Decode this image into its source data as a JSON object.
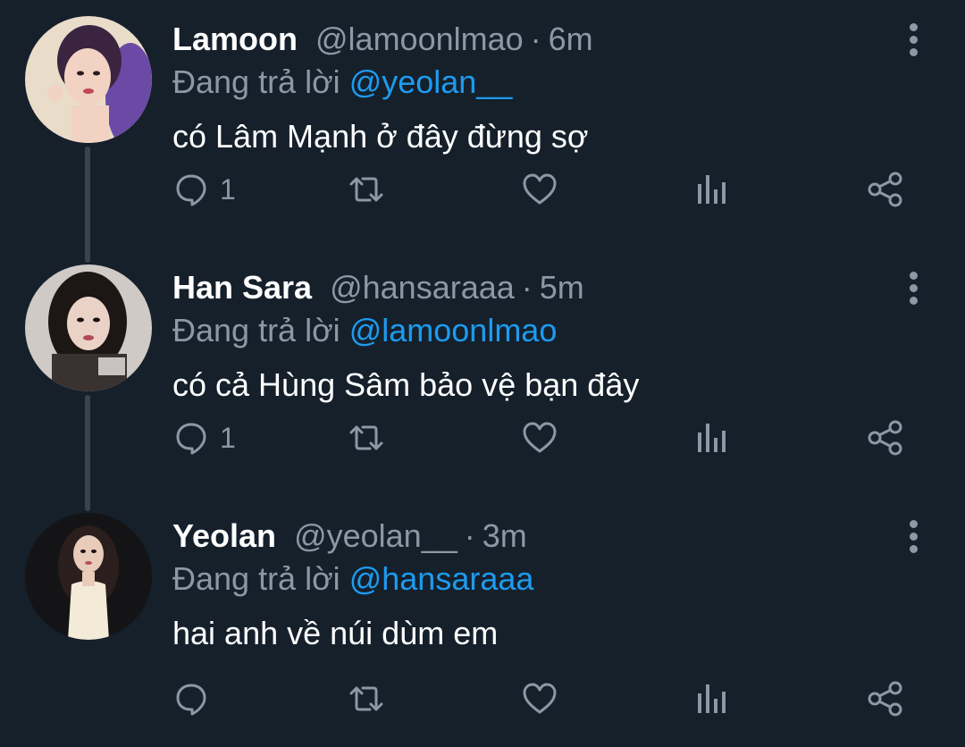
{
  "thread": {
    "tweets": [
      {
        "name": "Lamoon",
        "handle": "@lamoonlmao",
        "separator": "·",
        "time": "6m",
        "reply_prefix": "Đang trả lời",
        "reply_to": "@yeolan__",
        "text": "có Lâm Mạnh ở đây đừng sợ",
        "reply_count": "1"
      },
      {
        "name": "Han Sara",
        "handle": "@hansaraaa",
        "separator": "·",
        "time": "5m",
        "reply_prefix": "Đang trả lời",
        "reply_to": "@lamoonlmao",
        "text": "có cả Hùng Sâm bảo vệ bạn đây",
        "reply_count": "1"
      },
      {
        "name": "Yeolan",
        "handle": "@yeolan__",
        "separator": "·",
        "time": "3m",
        "reply_prefix": "Đang trả lời",
        "reply_to": "@hansaraaa",
        "text": "hai anh về núi dùm em",
        "reply_count": ""
      }
    ]
  },
  "icons": {
    "reply": "reply-icon",
    "retweet": "retweet-icon",
    "like": "heart-icon",
    "views": "analytics-icon",
    "share": "share-icon",
    "more": "more-vertical-icon"
  },
  "colors": {
    "background": "#15202b",
    "primary_text": "#ffffff",
    "secondary_text": "#8b98a5",
    "mention": "#1d9bf0",
    "thread_line": "#38444d"
  }
}
